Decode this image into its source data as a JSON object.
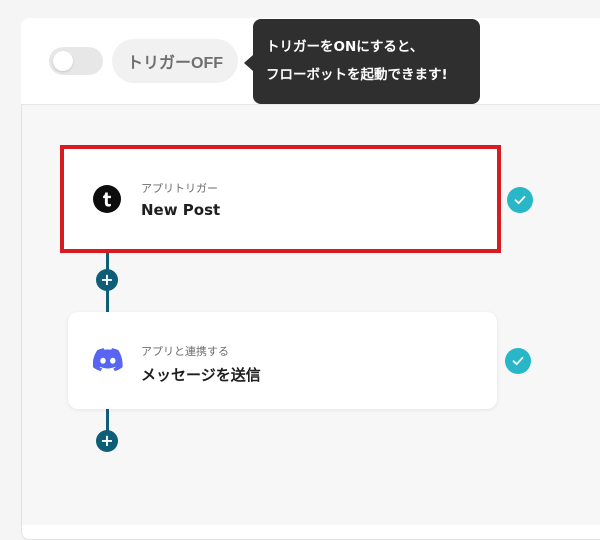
{
  "header": {
    "toggle_state": "off",
    "trigger_status_label": "トリガーOFF",
    "tooltip": {
      "line1": "トリガーをONにすると、",
      "line2": "フローボットを起動できます!"
    }
  },
  "flow": {
    "steps": [
      {
        "type_label": "アプリトリガー",
        "title": "New Post",
        "app_icon": "tumblr-icon",
        "status": "complete",
        "highlighted": true
      },
      {
        "type_label": "アプリと連携する",
        "title": "メッセージを送信",
        "app_icon": "discord-icon",
        "status": "complete",
        "highlighted": false
      }
    ],
    "add_step_symbol": "+"
  },
  "colors": {
    "highlight_border": "#d81b20",
    "connector": "#0f5e78",
    "check": "#27b7c7",
    "discord": "#5865f2",
    "tooltip_bg": "#2f2f2f"
  }
}
